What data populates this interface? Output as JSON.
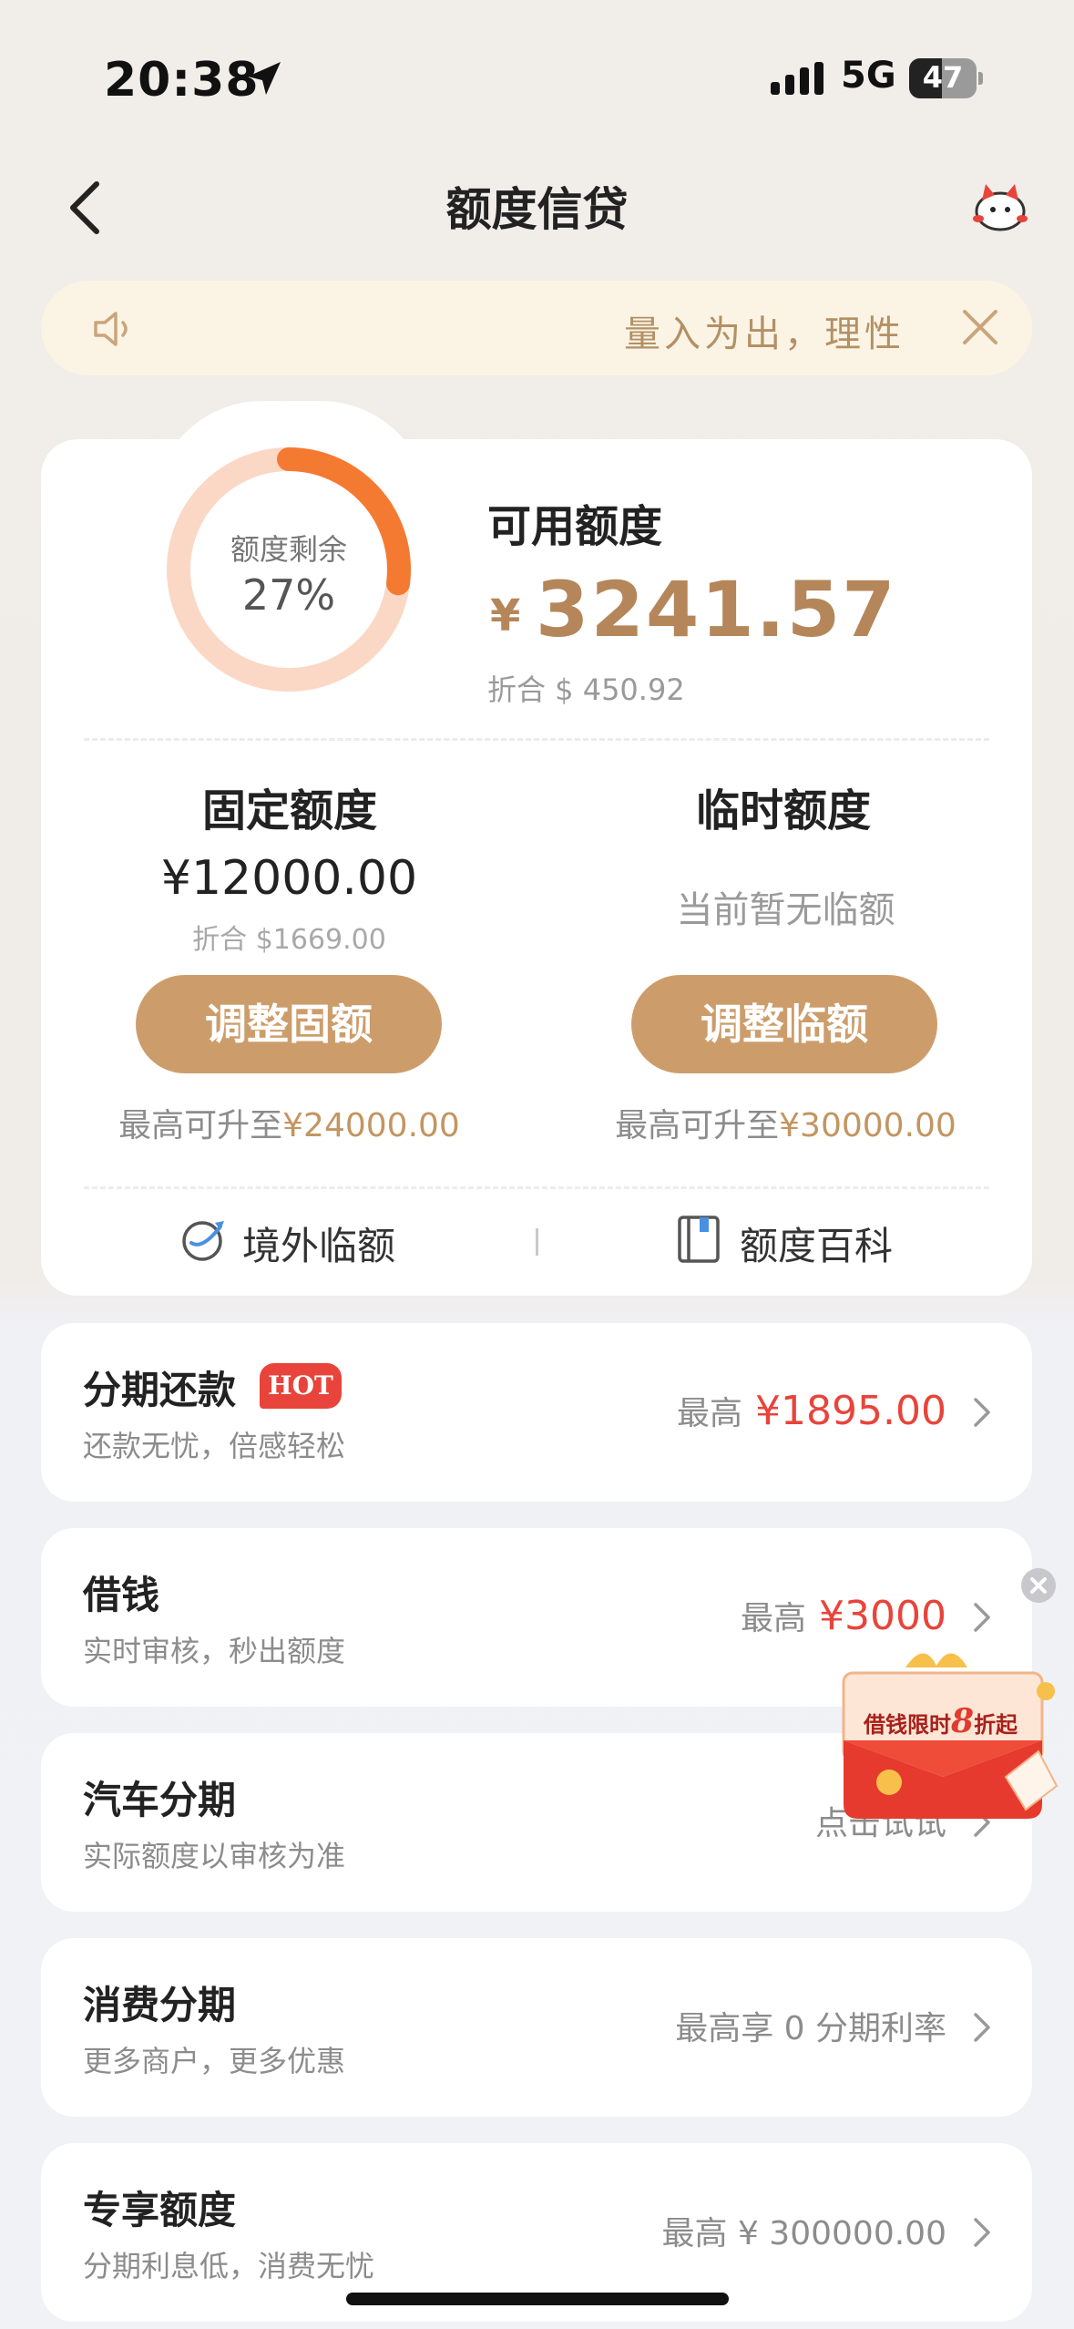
{
  "status_bar": {
    "time": "20:38",
    "network": "5G",
    "battery": "47"
  },
  "nav": {
    "title": "额度信贷"
  },
  "notice": {
    "text": "量入为出，理性"
  },
  "ring": {
    "label": "额度剩余",
    "percent_text": "27%",
    "percent": 0.27
  },
  "available": {
    "title": "可用额度",
    "currency": "¥",
    "amount": "3241.57",
    "converted": "折合 $ 450.92"
  },
  "fixed": {
    "title": "固定额度",
    "amount": "¥12000.00",
    "converted": "折合 $1669.00",
    "button": "调整固额",
    "max_prefix": "最高可升至",
    "max_value": "¥24000.00"
  },
  "temporary": {
    "title": "临时额度",
    "status": "当前暂无临额",
    "button": "调整临额",
    "max_prefix": "最高可升至",
    "max_value": "¥30000.00"
  },
  "quick_links": [
    {
      "label": "境外临额",
      "icon": "plane-globe-icon"
    },
    {
      "label": "额度百科",
      "icon": "book-icon"
    }
  ],
  "services": [
    {
      "title": "分期还款",
      "badge": "HOT",
      "subtitle": "还款无忧，倍感轻松",
      "right_prefix": "最高",
      "right_value": "¥1895.00"
    },
    {
      "title": "借钱",
      "subtitle": "实时审核，秒出额度",
      "right_prefix": "最高",
      "right_value": "¥3000"
    },
    {
      "title": "汽车分期",
      "subtitle": "实际额度以审核为准",
      "right_prefix": "点击试试",
      "right_value": ""
    },
    {
      "title": "消费分期",
      "subtitle": "更多商户，更多优惠",
      "right_prefix": "最高享 0 分期利率",
      "right_value": ""
    },
    {
      "title": "专享额度",
      "subtitle": "分期利息低，消费无忧",
      "right_prefix": "最高 ¥ 300000.00",
      "right_value": ""
    }
  ],
  "promo": {
    "text_prefix": "借钱限时",
    "text_big": "8",
    "text_suffix": "折起"
  },
  "colors": {
    "accent_gold": "#cc9d6b",
    "ring_orange": "#f47a32",
    "ring_track": "#fbd8c6",
    "price_red": "#e8443b"
  }
}
